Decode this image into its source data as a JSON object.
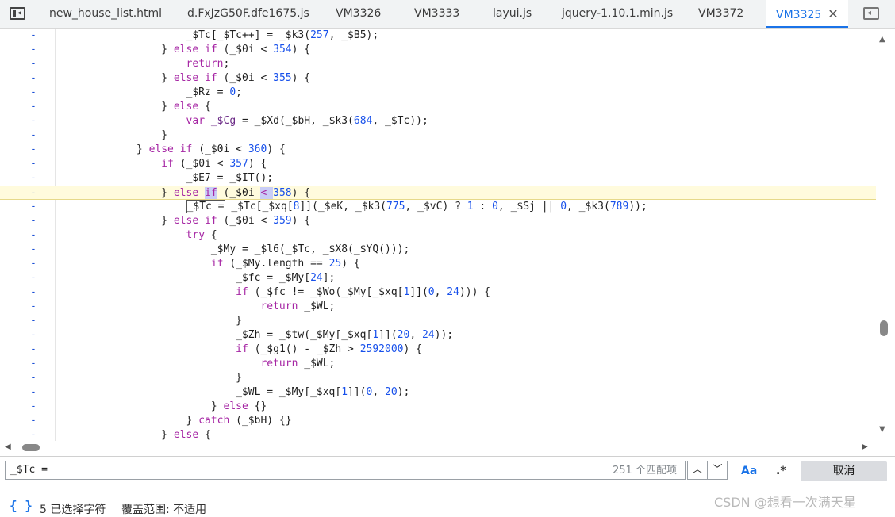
{
  "tabs": [
    {
      "label": "new_house_list.html"
    },
    {
      "label": "d.FxJzG50F.dfe1675.js"
    },
    {
      "label": "VM3326"
    },
    {
      "label": "VM3333"
    },
    {
      "label": "layui.js"
    },
    {
      "label": "jquery-1.10.1.min.js"
    },
    {
      "label": "VM3372"
    },
    {
      "label": "VM3325",
      "active": true
    }
  ],
  "code_lines": [
    {
      "marker": "-",
      "parts": [
        [
          "t",
          "                    _$Tc[_$Tc++] = _$k3("
        ],
        [
          "n",
          "257"
        ],
        [
          "t",
          ", _$B5);"
        ]
      ]
    },
    {
      "marker": "-",
      "parts": [
        [
          "t",
          "                } "
        ],
        [
          "k",
          "else if"
        ],
        [
          "t",
          " (_$0i < "
        ],
        [
          "n",
          "354"
        ],
        [
          "t",
          ") {"
        ]
      ]
    },
    {
      "marker": "-",
      "parts": [
        [
          "t",
          "                    "
        ],
        [
          "k",
          "return"
        ],
        [
          "t",
          ";"
        ]
      ]
    },
    {
      "marker": "-",
      "parts": [
        [
          "t",
          "                } "
        ],
        [
          "k",
          "else if"
        ],
        [
          "t",
          " (_$0i < "
        ],
        [
          "n",
          "355"
        ],
        [
          "t",
          ") {"
        ]
      ]
    },
    {
      "marker": "-",
      "parts": [
        [
          "t",
          "                    _$Rz = "
        ],
        [
          "n",
          "0"
        ],
        [
          "t",
          ";"
        ]
      ]
    },
    {
      "marker": "-",
      "parts": [
        [
          "t",
          "                } "
        ],
        [
          "k",
          "else"
        ],
        [
          "t",
          " {"
        ]
      ]
    },
    {
      "marker": "-",
      "parts": [
        [
          "t",
          "                    "
        ],
        [
          "k",
          "var"
        ],
        [
          "t",
          " "
        ],
        [
          "i",
          "_$Cg"
        ],
        [
          "t",
          " = _$Xd(_$bH, _$k3("
        ],
        [
          "n",
          "684"
        ],
        [
          "t",
          ", _$Tc));"
        ]
      ]
    },
    {
      "marker": "-",
      "parts": [
        [
          "t",
          "                }"
        ]
      ]
    },
    {
      "marker": "-",
      "parts": [
        [
          "t",
          "            } "
        ],
        [
          "k",
          "else if"
        ],
        [
          "t",
          " (_$0i < "
        ],
        [
          "n",
          "360"
        ],
        [
          "t",
          ") {"
        ]
      ]
    },
    {
      "marker": "-",
      "parts": [
        [
          "t",
          "                "
        ],
        [
          "k",
          "if"
        ],
        [
          "t",
          " (_$0i < "
        ],
        [
          "n",
          "357"
        ],
        [
          "t",
          ") {"
        ]
      ]
    },
    {
      "marker": "-",
      "parts": [
        [
          "t",
          "                    _$E7 = _$IT();"
        ]
      ]
    },
    {
      "marker": "-",
      "highlight": true,
      "parts": [
        [
          "t",
          "                } "
        ],
        [
          "k",
          "else "
        ],
        [
          "s",
          "if"
        ],
        [
          "t",
          " (_$0i "
        ],
        [
          "s2",
          "< "
        ],
        [
          "n",
          "358"
        ],
        [
          "t",
          ") {"
        ]
      ]
    },
    {
      "marker": "-",
      "parts": [
        [
          "t",
          "                    "
        ],
        [
          "b",
          "_$Tc ="
        ],
        [
          "t",
          " _$Tc[_$xq["
        ],
        [
          "n",
          "8"
        ],
        [
          "t",
          "]](_$eK, _$k3("
        ],
        [
          "n",
          "775"
        ],
        [
          "t",
          ", _$vC) ? "
        ],
        [
          "n",
          "1"
        ],
        [
          "t",
          " : "
        ],
        [
          "n",
          "0"
        ],
        [
          "t",
          ", _$Sj || "
        ],
        [
          "n",
          "0"
        ],
        [
          "t",
          ", _$k3("
        ],
        [
          "n",
          "789"
        ],
        [
          "t",
          "));"
        ]
      ]
    },
    {
      "marker": "-",
      "parts": [
        [
          "t",
          "                } "
        ],
        [
          "k",
          "else if"
        ],
        [
          "t",
          " (_$0i < "
        ],
        [
          "n",
          "359"
        ],
        [
          "t",
          ") {"
        ]
      ]
    },
    {
      "marker": "-",
      "parts": [
        [
          "t",
          "                    "
        ],
        [
          "k",
          "try"
        ],
        [
          "t",
          " {"
        ]
      ]
    },
    {
      "marker": "-",
      "parts": [
        [
          "t",
          "                        _$My = _$l6(_$Tc, _$X8(_$YQ()));"
        ]
      ]
    },
    {
      "marker": "-",
      "parts": [
        [
          "t",
          "                        "
        ],
        [
          "k",
          "if"
        ],
        [
          "t",
          " (_$My.length == "
        ],
        [
          "n",
          "25"
        ],
        [
          "t",
          ") {"
        ]
      ]
    },
    {
      "marker": "-",
      "parts": [
        [
          "t",
          "                            _$fc = _$My["
        ],
        [
          "n",
          "24"
        ],
        [
          "t",
          "];"
        ]
      ]
    },
    {
      "marker": "-",
      "parts": [
        [
          "t",
          "                            "
        ],
        [
          "k",
          "if"
        ],
        [
          "t",
          " (_$fc != _$Wo(_$My[_$xq["
        ],
        [
          "n",
          "1"
        ],
        [
          "t",
          "]]("
        ],
        [
          "n",
          "0"
        ],
        [
          "t",
          ", "
        ],
        [
          "n",
          "24"
        ],
        [
          "t",
          "))) {"
        ]
      ]
    },
    {
      "marker": "-",
      "parts": [
        [
          "t",
          "                                "
        ],
        [
          "k",
          "return"
        ],
        [
          "t",
          " _$WL;"
        ]
      ]
    },
    {
      "marker": "-",
      "parts": [
        [
          "t",
          "                            }"
        ]
      ]
    },
    {
      "marker": "-",
      "parts": [
        [
          "t",
          "                            _$Zh = _$tw(_$My[_$xq["
        ],
        [
          "n",
          "1"
        ],
        [
          "t",
          "]]("
        ],
        [
          "n",
          "20"
        ],
        [
          "t",
          ", "
        ],
        [
          "n",
          "24"
        ],
        [
          "t",
          "));"
        ]
      ]
    },
    {
      "marker": "-",
      "parts": [
        [
          "t",
          "                            "
        ],
        [
          "k",
          "if"
        ],
        [
          "t",
          " (_$g1() - _$Zh > "
        ],
        [
          "n",
          "2592000"
        ],
        [
          "t",
          ") {"
        ]
      ]
    },
    {
      "marker": "-",
      "parts": [
        [
          "t",
          "                                "
        ],
        [
          "k",
          "return"
        ],
        [
          "t",
          " _$WL;"
        ]
      ]
    },
    {
      "marker": "-",
      "parts": [
        [
          "t",
          "                            }"
        ]
      ]
    },
    {
      "marker": "-",
      "parts": [
        [
          "t",
          "                            _$WL = _$My[_$xq["
        ],
        [
          "n",
          "1"
        ],
        [
          "t",
          "]]("
        ],
        [
          "n",
          "0"
        ],
        [
          "t",
          ", "
        ],
        [
          "n",
          "20"
        ],
        [
          "t",
          ");"
        ]
      ]
    },
    {
      "marker": "-",
      "parts": [
        [
          "t",
          "                        } "
        ],
        [
          "k",
          "else"
        ],
        [
          "t",
          " {}"
        ]
      ]
    },
    {
      "marker": "-",
      "parts": [
        [
          "t",
          "                    } "
        ],
        [
          "k",
          "catch"
        ],
        [
          "t",
          " (_$bH) {}"
        ]
      ]
    },
    {
      "marker": "-",
      "parts": [
        [
          "t",
          "                } "
        ],
        [
          "k",
          "else"
        ],
        [
          "t",
          " {"
        ]
      ]
    }
  ],
  "search": {
    "query": "_$Tc =",
    "match_count": "251 个匹配项",
    "prev_icon": "chevron-up-icon",
    "next_icon": "chevron-down-icon",
    "case_label": "Aa",
    "regex_label": ".*",
    "cancel_label": "取消"
  },
  "status": {
    "braces": "{ }",
    "selected_chars": "5 已选择字符",
    "coverage": "覆盖范围: 不适用"
  },
  "watermark": "CSDN @想看一次满天星",
  "colors": {
    "accent": "#1a73e8",
    "keyword": "#a626a4",
    "number": "#1750eb",
    "highlight": "#fffbdd"
  }
}
